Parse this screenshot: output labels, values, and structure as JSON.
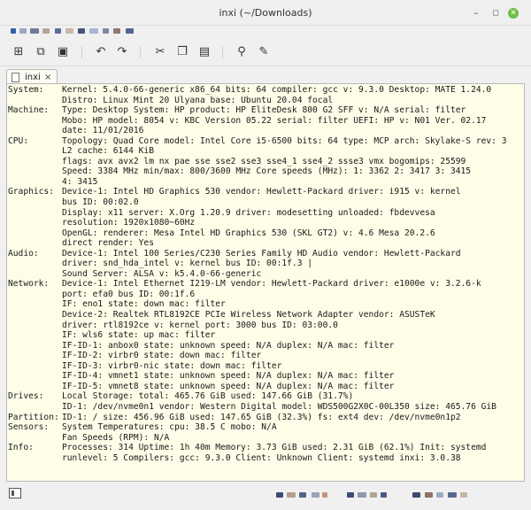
{
  "window": {
    "title": "inxi (~/Downloads)"
  },
  "toolbar": {
    "icons": [
      "new-file-icon",
      "open-file-icon",
      "save-icon",
      "undo-icon",
      "redo-icon",
      "cut-icon",
      "copy-icon",
      "paste-icon",
      "find-icon",
      "find-replace-icon"
    ]
  },
  "tab": {
    "label": "inxi",
    "close": "×"
  },
  "lines": [
    {
      "label": "System:",
      "text": "Kernel: 5.4.0-66-generic x86_64 bits: 64 compiler: gcc v: 9.3.0 Desktop: MATE 1.24.0"
    },
    {
      "label": "",
      "text": "Distro: Linux Mint 20 Ulyana base: Ubuntu 20.04 focal"
    },
    {
      "label": "Machine:",
      "text": "Type: Desktop System: HP product: HP EliteDesk 800 G2 SFF v: N/A serial: filter"
    },
    {
      "label": "",
      "text": "Mobo: HP model: 8054 v: KBC Version 05.22 serial: filter UEFI: HP v: N01 Ver. 02.17"
    },
    {
      "label": "",
      "text": "date: 11/01/2016"
    },
    {
      "label": "CPU:",
      "text": "Topology: Quad Core model: Intel Core i5-6500 bits: 64 type: MCP arch: Skylake-S rev: 3"
    },
    {
      "label": "",
      "text": "L2 cache: 6144 KiB"
    },
    {
      "label": "",
      "text": "flags: avx avx2 lm nx pae sse sse2 sse3 sse4_1 sse4_2 ssse3 vmx bogomips: 25599"
    },
    {
      "label": "",
      "text": "Speed: 3384 MHz min/max: 800/3600 MHz Core speeds (MHz): 1: 3362 2: 3417 3: 3415"
    },
    {
      "label": "",
      "text": "4: 3415"
    },
    {
      "label": "Graphics:",
      "text": "Device-1: Intel HD Graphics 530 vendor: Hewlett-Packard driver: i915 v: kernel"
    },
    {
      "label": "",
      "text": "bus ID: 00:02.0"
    },
    {
      "label": "",
      "text": "Display: x11 server: X.Org 1.20.9 driver: modesetting unloaded: fbdevvesa"
    },
    {
      "label": "",
      "text": "resolution: 1920x1080~60Hz"
    },
    {
      "label": "",
      "text": "OpenGL: renderer: Mesa Intel HD Graphics 530 (SKL GT2) v: 4.6 Mesa 20.2.6"
    },
    {
      "label": "",
      "text": "direct render: Yes"
    },
    {
      "label": "Audio:",
      "text": "Device-1: Intel 100 Series/C230 Series Family HD Audio vendor: Hewlett-Packard"
    },
    {
      "label": "",
      "text": "driver: snd_hda_intel v: kernel bus ID: 00:1f.3 |"
    },
    {
      "label": "",
      "text": "Sound Server: ALSA v: k5.4.0-66-generic"
    },
    {
      "label": "Network:",
      "text": "Device-1: Intel Ethernet I219-LM vendor: Hewlett-Packard driver: e1000e v: 3.2.6-k"
    },
    {
      "label": "",
      "text": "port: efa0 bus ID: 00:1f.6"
    },
    {
      "label": "",
      "text": "IF: eno1 state: down mac: filter"
    },
    {
      "label": "",
      "text": "Device-2: Realtek RTL8192CE PCIe Wireless Network Adapter vendor: ASUSTeK"
    },
    {
      "label": "",
      "text": "driver: rtl8192ce v: kernel port: 3000 bus ID: 03:00.0"
    },
    {
      "label": "",
      "text": "IF: wls6 state: up mac: filter"
    },
    {
      "label": "",
      "text": "IF-ID-1: anbox0 state: unknown speed: N/A duplex: N/A mac: filter"
    },
    {
      "label": "",
      "text": "IF-ID-2: virbr0 state: down mac: filter"
    },
    {
      "label": "",
      "text": "IF-ID-3: virbr0-nic state: down mac: filter"
    },
    {
      "label": "",
      "text": "IF-ID-4: vmnet1 state: unknown speed: N/A duplex: N/A mac: filter"
    },
    {
      "label": "",
      "text": "IF-ID-5: vmnet8 state: unknown speed: N/A duplex: N/A mac: filter"
    },
    {
      "label": "Drives:",
      "text": "Local Storage: total: 465.76 GiB used: 147.66 GiB (31.7%)"
    },
    {
      "label": "",
      "text": "ID-1: /dev/nvme0n1 vendor: Western Digital model: WDS500G2X0C-00L350 size: 465.76 GiB"
    },
    {
      "label": "Partition:",
      "text": "ID-1: / size: 456.96 GiB used: 147.65 GiB (32.3%) fs: ext4 dev: /dev/nvme0n1p2"
    },
    {
      "label": "Sensors:",
      "text": "System Temperatures: cpu: 38.5 C mobo: N/A"
    },
    {
      "label": "",
      "text": "Fan Speeds (RPM): N/A"
    },
    {
      "label": "Info:",
      "text": "Processes: 314 Uptime: 1h 40m Memory: 3.73 GiB used: 2.31 GiB (62.1%) Init: systemd"
    },
    {
      "label": "",
      "text": "runlevel: 5 Compilers: gcc: 9.3.0 Client: Unknown Client: systemd inxi: 3.0.38"
    }
  ]
}
